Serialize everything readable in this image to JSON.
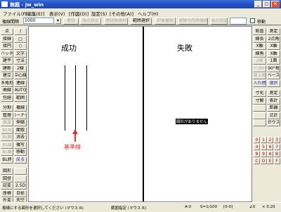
{
  "window": {
    "title": "無題 - jw_win",
    "icon": "jw-app-icon"
  },
  "menu": [
    "ファイル(F)",
    "[編集(E)]",
    "表示(V)",
    "[作図(D)]",
    "設定(S)",
    "[その他(A)]",
    "ヘルプ(H)"
  ],
  "toolbar": {
    "spacing_label": "複線間隔",
    "spacing_value": "1000",
    "buttons": [
      "連続",
      "端点指定",
      "連続線選択",
      "範囲選択",
      "前後複線",
      "留線付両側複線",
      "端点指定"
    ],
    "move_label": "移動"
  },
  "left_tools": [
    [
      "点",
      "/"
    ],
    [
      "接線",
      "□"
    ],
    [
      "接円",
      "○"
    ],
    [
      "ハッチ",
      "文字"
    ],
    [
      "建平",
      "寸法"
    ],
    [
      "建断",
      "2線"
    ],
    [
      "建立",
      "中心線"
    ],
    [
      "多角形",
      "連線"
    ],
    [
      "曲線",
      "AUTO"
    ],
    [
      "包絡",
      "範囲"
    ],
    [
      "分割",
      "複線"
    ],
    [
      "整理",
      "コーナー"
    ],
    [
      "属変",
      "伸縮"
    ],
    [
      "BL化",
      "面取"
    ],
    [
      "BL解",
      "消去"
    ],
    [
      "BL属",
      "複写"
    ],
    [
      "BL編",
      "移動"
    ],
    [
      "BL終",
      "戻る"
    ],
    [
      "図形",
      ""
    ],
    [
      "図登",
      ""
    ],
    [
      "記変",
      "2.5D"
    ],
    [
      "座標",
      "日影"
    ],
    [
      "外変",
      "天空"
    ]
  ],
  "right_tools": [
    [
      "鉛直",
      "測定"
    ],
    [
      "線長",
      "2点角"
    ],
    [
      "X軸",
      "X軸"
    ],
    [
      "線角",
      "X軸"
    ],
    [
      "2線",
      "1面"
    ],
    [
      "0°/90°",
      "90°毎"
    ],
    [
      "線上角",
      "ベース"
    ],
    [
      "入れ替",
      "選択"
    ],
    [
      "寸化",
      "測定"
    ],
    [
      "寸解",
      "表計"
    ],
    [
      "",
      "距離"
    ],
    [
      "",
      "式計"
    ],
    [
      "",
      "ガウス"
    ]
  ],
  "layer_buttons": [
    "0",
    "1",
    "2",
    "3",
    "4",
    "5",
    "6",
    "7",
    "8",
    "9",
    "A",
    "B",
    "C",
    "D",
    "E",
    "F"
  ],
  "drawing": {
    "label_success": "成功",
    "label_failure": "失敗",
    "annotation": "基準線",
    "message": "図形がありません"
  },
  "status": {
    "hint": "複線にする図形を選択してください (マウス R)",
    "mode": "範囲指定 (マウス R)",
    "scale": "S=1/100",
    "size": "A-0",
    "range": "[0-0]",
    "angle": "∠0",
    "zoom": "× 0.20"
  },
  "colors": {
    "annotation": "#e03030",
    "titlebar": "#2354c7"
  }
}
